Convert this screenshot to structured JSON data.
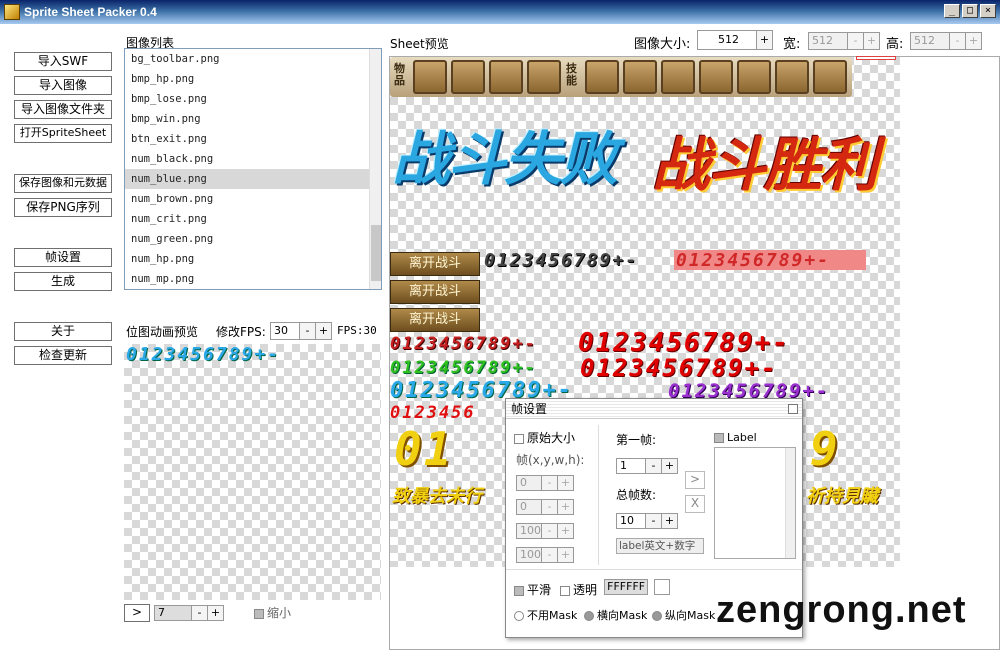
{
  "window": {
    "title": "Sprite Sheet Packer 0.4",
    "minimize": "_",
    "maximize": "□",
    "close": "×"
  },
  "left_buttons": {
    "import_swf": "导入SWF",
    "import_image": "导入图像",
    "import_folder": "导入图像文件夹",
    "open_spritesheet": "打开SpriteSheet",
    "save_image_meta": "保存图像和元数据",
    "save_png_seq": "保存PNG序列",
    "frame_settings": "帧设置",
    "generate": "生成",
    "about": "关于",
    "check_update": "检查更新"
  },
  "image_list": {
    "label": "图像列表",
    "items": [
      "bg_toolbar.png",
      "bmp_hp.png",
      "bmp_lose.png",
      "bmp_win.png",
      "btn_exit.png",
      "num_black.png",
      "num_blue.png",
      "num_brown.png",
      "num_crit.png",
      "num_green.png",
      "num_hp.png",
      "num_mp.png"
    ],
    "selected": "num_blue.png"
  },
  "anim_preview": {
    "label": "位图动画预览",
    "fps_edit_label": "修改FPS:",
    "fps_value": "30",
    "fps_display": "FPS:30",
    "sample_digits": "0123456789+-",
    "play_button": ">",
    "frame_value": "7",
    "shrink_label": "缩小"
  },
  "sheet": {
    "label": "Sheet预览",
    "size_label": "图像大小:",
    "size_value": "512",
    "width_label": "宽:",
    "width_value": "512",
    "height_label": "高:",
    "height_value": "512",
    "toolbar_items_label": "物品",
    "toolbar_skills_label": "技能",
    "lose_text": "战斗失败",
    "win_text": "战斗胜利",
    "leave_button": "离开战斗",
    "digits": "0123456789+-",
    "partial_digits": "0123456",
    "big_partial_left": "01",
    "big_partial_right": "9",
    "crit_text_left": "致暴去未行",
    "crit_text_right": "祈持見贜"
  },
  "frame_dialog": {
    "title": "帧设置",
    "original_size": "原始大小",
    "frame_xywh": "帧(x,y,w,h):",
    "x": "0",
    "y": "0",
    "w": "100",
    "h": "100",
    "first_frame_label": "第一帧:",
    "first_frame_value": "1",
    "total_frames_label": "总帧数:",
    "total_frames_value": "10",
    "label_placeholder": "label英文+数字",
    "label_checkbox": "Label",
    "arrow_button": ">",
    "x_button": "X",
    "smooth": "平滑",
    "transparent": "透明",
    "color_value": "FFFFFF",
    "mask_none": "不用Mask",
    "mask_horizontal": "横向Mask",
    "mask_vertical": "纵向Mask"
  },
  "watermark": "zengrong.net",
  "colors": {
    "title_bar": "#0a246a",
    "list_border": "#7f9db9",
    "selection": "#d8d8d8"
  }
}
